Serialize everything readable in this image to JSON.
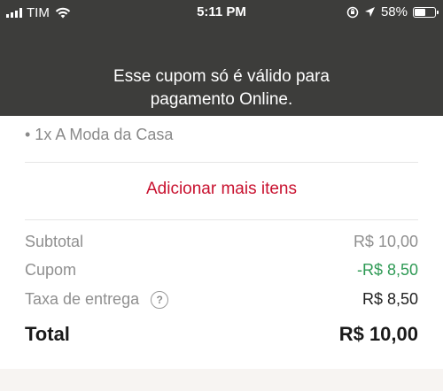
{
  "status_bar": {
    "carrier": "TIM",
    "time": "5:11 PM",
    "battery": "58%",
    "battery_level": 0.58
  },
  "toast": {
    "line1": "Esse cupom só é válido para",
    "line2": "pagamento Online."
  },
  "order": {
    "item": "• 1x A Moda da Casa",
    "add_more": "Adicionar mais itens"
  },
  "summary": {
    "subtotal_label": "Subtotal",
    "subtotal_value": "R$ 10,00",
    "coupon_label": "Cupom",
    "coupon_value": "-R$ 8,50",
    "delivery_label": "Taxa de entrega",
    "delivery_help": "?",
    "delivery_value": "R$ 8,50",
    "total_label": "Total",
    "total_value": "R$ 10,00"
  },
  "colors": {
    "overlay": "#3d3d3b",
    "accent": "#c8102e",
    "discount": "#2f9a55"
  }
}
